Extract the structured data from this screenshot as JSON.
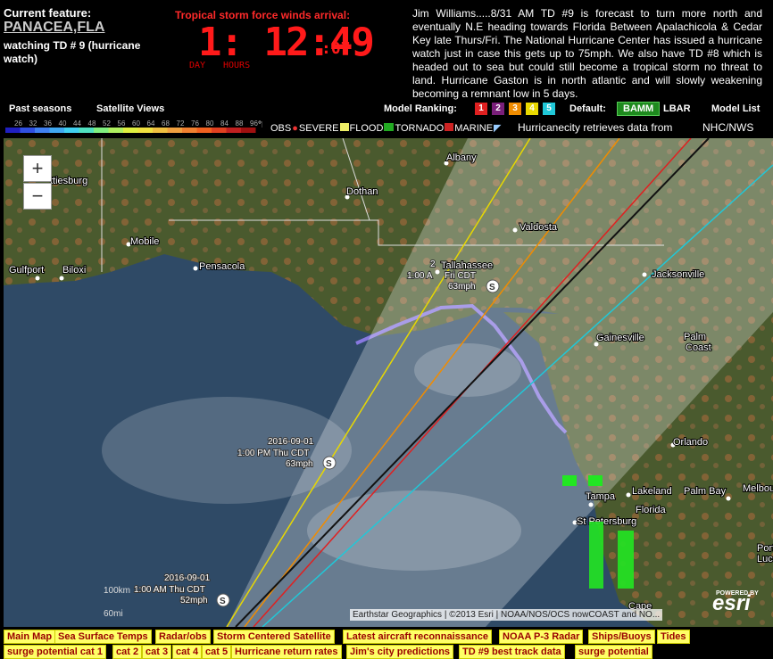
{
  "header": {
    "current_feature_label": "Current feature:",
    "current_place": "PANACEA,FLA",
    "current_desc": "watching TD # 9 (hurricane watch)",
    "ts_title": "Tropical storm force winds arrival:",
    "countdown_main": "1: 12:49",
    "countdown_seconds": ":07",
    "countdown_day_label": "DAY",
    "countdown_hours_label": "HOURS",
    "news": "Jim Williams.....8/31 AM TD #9 is forecast to turn more north and eventually N.E heading towards Florida Between Apalachicola & Cedar Key late Thurs/Fri. The National Hurricane Center has issued a hurricane watch just in case this gets up to 75mph. We also have TD #8 which is headed out to sea but could still become a tropical storm no threat to land. Hurricane Gaston is in north atlantic and will slowly weakening becoming a remnant low in 5 days."
  },
  "nav": {
    "past_seasons": "Past seasons",
    "satellite_views": "Satellite Views",
    "model_ranking_label": "Model Ranking:",
    "ranks": [
      {
        "label": "1",
        "color": "#e02020"
      },
      {
        "label": "2",
        "color": "#7a1f7a"
      },
      {
        "label": "3",
        "color": "#f08c00"
      },
      {
        "label": "4",
        "color": "#e8d800"
      },
      {
        "label": "5",
        "color": "#20c8d8"
      }
    ],
    "default_label": "Default:",
    "bamm": "BAMM",
    "lbar": "LBAR",
    "model_list": "Model List"
  },
  "legend": {
    "temps": [
      "26",
      "32",
      "36",
      "40",
      "44",
      "48",
      "52",
      "56",
      "60",
      "64",
      "68",
      "72",
      "76",
      "80",
      "84",
      "88",
      "96"
    ],
    "unit": "°F",
    "obs": "OBS",
    "severe": "SEVERE",
    "flood": "FLOOD",
    "tornado": "TORNADO",
    "marine": "MARINE",
    "retrieves": "Hurricanecity retrieves data from",
    "source": "NHC/NWS"
  },
  "map": {
    "zoom_in": "+",
    "zoom_out": "−",
    "cities": {
      "albany": "Albany",
      "dothan": "Dothan",
      "hattiesburg": "ttiesburg",
      "mobile": "Mobile",
      "pensacola": "Pensacola",
      "gulfport": "Gulfport",
      "biloxi": "Biloxi",
      "valdosta": "Valdosta",
      "tallahassee": "Tallahassee",
      "jacksonville": "Jacksonville",
      "gainesville": "Gainesville",
      "palm_coast_1": "Palm",
      "palm_coast_2": "Coast",
      "orlando": "Orlando",
      "tampa": "Tampa",
      "lakeland": "Lakeland",
      "palm_bay": "Palm Bay",
      "florida": "Florida",
      "st_petersburg": "St Petersburg",
      "melbourne": "Melbou",
      "port1": "Port",
      "port2": "Luc",
      "cape": "Cape"
    },
    "storm_points": [
      {
        "date": "2016-09-01",
        "time": "1:00 AM Thu CDT",
        "wind": "52mph",
        "symbol": "S"
      },
      {
        "date": "2016-09-01",
        "time": "1:00 PM Thu CDT",
        "wind": "63mph",
        "symbol": "S"
      },
      {
        "date": "2",
        "time": "1:00 A",
        "day": "Fri CDT",
        "wind": "63mph",
        "symbol": "S"
      }
    ],
    "scale": "100km",
    "scale_mi": "60mi",
    "attribution": "Earthstar Geographics | ©2013 Esri | NOAA/NOS/OCS nowCOAST and NO...",
    "powered_by": "POWERED BY",
    "esri": "esri"
  },
  "bottom_nav": {
    "row1": [
      "Main Map",
      "Sea Surface Temps",
      "Radar/obs",
      "Storm Centered Satellite",
      "Latest aircraft reconnaissance",
      "NOAA P-3 Radar",
      "Ships/Buoys",
      "Tides"
    ],
    "row2": [
      "surge potential cat 1",
      "cat 2",
      "cat 3",
      "cat 4",
      "cat 5",
      "Hurricane return rates",
      "Jim's city predictions",
      "TD #9 best track data",
      "surge potential"
    ]
  }
}
